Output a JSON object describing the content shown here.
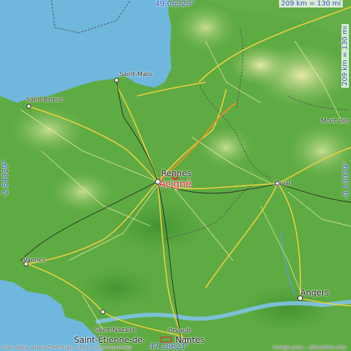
{
  "map": {
    "focus_place": "Acigné",
    "labels": {
      "saint_malo": "Saint-Malo",
      "saint_brieuc": "Saint-Brieuc",
      "rennes": "Rennes",
      "laval": "Laval",
      "vannes": "Vannes",
      "angers": "Angers",
      "saint_nazaire": "Saint-Nazaire",
      "saint_etienne": "Saint-Étienne-de-",
      "orvault": "Orvault",
      "nantes": "Nantes",
      "mont_des": "Mont des"
    },
    "coords": {
      "top_lat": "49.06329°",
      "bottom_lat": "47.18621°",
      "left_lon": "-2.84329°",
      "right_lon": "-0.13079°"
    },
    "scale": {
      "top": "209 km = 130 mi",
      "right": "209 km = 130 mi"
    },
    "attribution": {
      "left": "map data: openstreetmap, style: opentopomap",
      "right": "image proc.: elevation.city"
    },
    "colors": {
      "sea": "#6fb7dd",
      "land_low": "#5aa83f",
      "land_mid": "#8cc46a",
      "land_high": "#e9e6a2",
      "road_major": "#f2d13a",
      "road_motorway": "#f28c2e",
      "boundary": "#555555",
      "focus_marker": "#e0202a",
      "coord_text": "#3a4fc8"
    }
  }
}
